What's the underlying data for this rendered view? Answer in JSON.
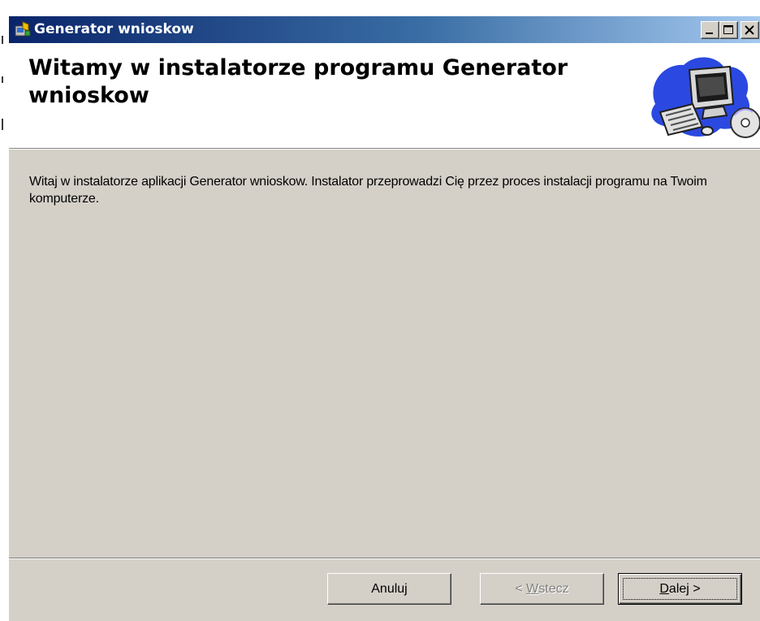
{
  "window": {
    "title": "Generator wnioskow",
    "controls": [
      "minimize",
      "maximize",
      "close"
    ]
  },
  "header": {
    "title": "Witamy w instalatorze programu Generator wnioskow",
    "graphic": "computer-cd-icon"
  },
  "body": {
    "message": "Witaj w instalatorze aplikacji Generator wnioskow. Instalator przeprowadzi Cię przez proces instalacji programu na Twoim komputerze."
  },
  "buttons": {
    "cancel_label": "Anuluj",
    "back": {
      "prefix": "< ",
      "mnemonic": "W",
      "rest": "stecz",
      "enabled": false
    },
    "next": {
      "mnemonic": "D",
      "rest": "alej >",
      "enabled": true,
      "default": true
    }
  },
  "colors": {
    "titlebar_start": "#0a246a",
    "titlebar_end": "#a6caf0",
    "face": "#d4d0c8",
    "header_bg": "#ffffff"
  }
}
